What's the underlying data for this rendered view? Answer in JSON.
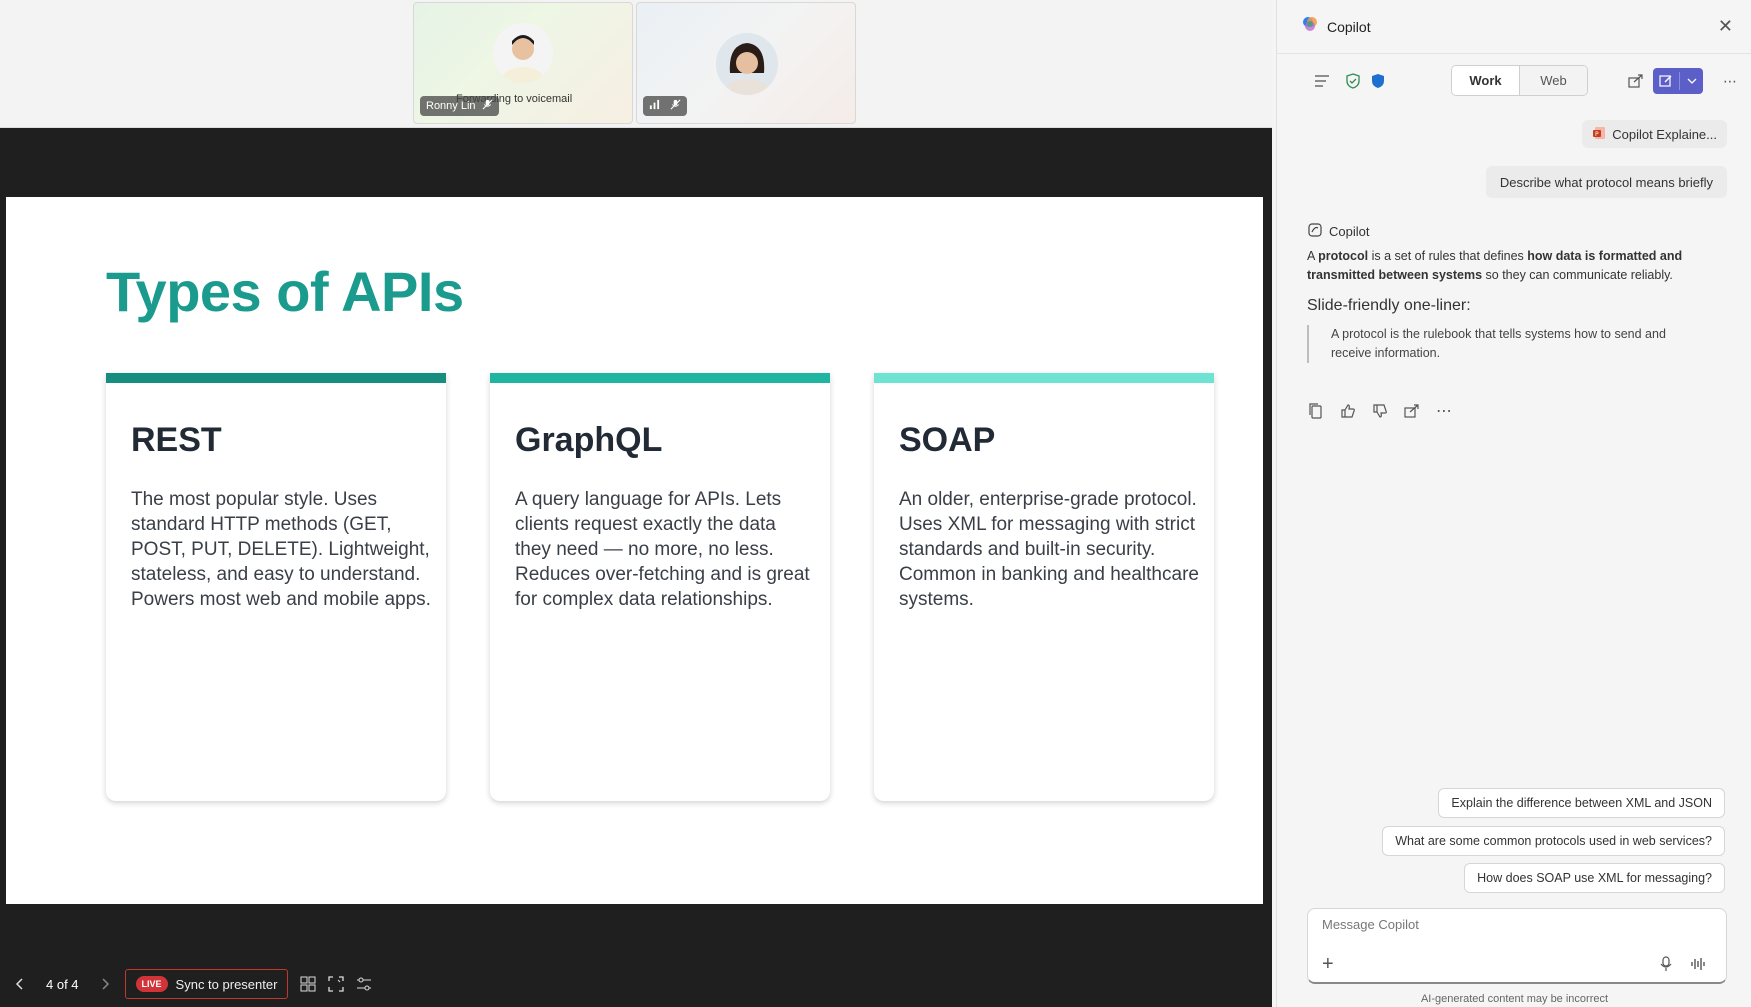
{
  "meeting": {
    "participants": [
      {
        "name": "Ronny Lin",
        "status": "Forwarding to voicemail"
      },
      {
        "name": ""
      }
    ]
  },
  "slide": {
    "title": "Types of APIs",
    "cards": [
      {
        "heading": "REST",
        "body": "The most popular style. Uses standard HTTP methods (GET, POST, PUT, DELETE). Lightweight, stateless, and easy to understand. Powers most web and mobile apps.",
        "accent": "#168d7f"
      },
      {
        "heading": "GraphQL",
        "body": "A query language for APIs. Lets clients request exactly the data they need — no more, no less. Reduces over-fetching and is great for complex data relationships.",
        "accent": "#1fb5a0"
      },
      {
        "heading": "SOAP",
        "body": "An older, enterprise-grade protocol. Uses XML for messaging with strict standards and built-in security. Common in banking and healthcare systems.",
        "accent": "#6ee3d2"
      }
    ]
  },
  "toolbar": {
    "page_indicator": "4 of 4",
    "live_badge": "LIVE",
    "sync_label": "Sync to presenter"
  },
  "copilot": {
    "title": "Copilot",
    "modes": [
      "Work",
      "Web"
    ],
    "file_chip": "Copilot Explaine...",
    "user_message": "Describe what protocol means briefly",
    "reply": {
      "author": "Copilot",
      "part1": "A ",
      "bold1": "protocol",
      "part2": " is a set of rules that defines ",
      "bold2": "how data is formatted and transmitted between systems",
      "part3": " so they can communicate reliably.",
      "heading": "Slide-friendly one-liner:",
      "quote": "A protocol is the rulebook that tells systems how to send and receive information."
    },
    "suggestions": [
      "Explain the difference between XML and JSON",
      "What are some common protocols used in web services?",
      "How does SOAP use XML for messaging?"
    ],
    "composer_placeholder": "Message Copilot",
    "disclaimer": "AI-generated content may be incorrect"
  },
  "colors": {
    "title_teal": "#1a9b8e",
    "accent_purple": "#5b5fc7",
    "live_red": "#d13438"
  }
}
